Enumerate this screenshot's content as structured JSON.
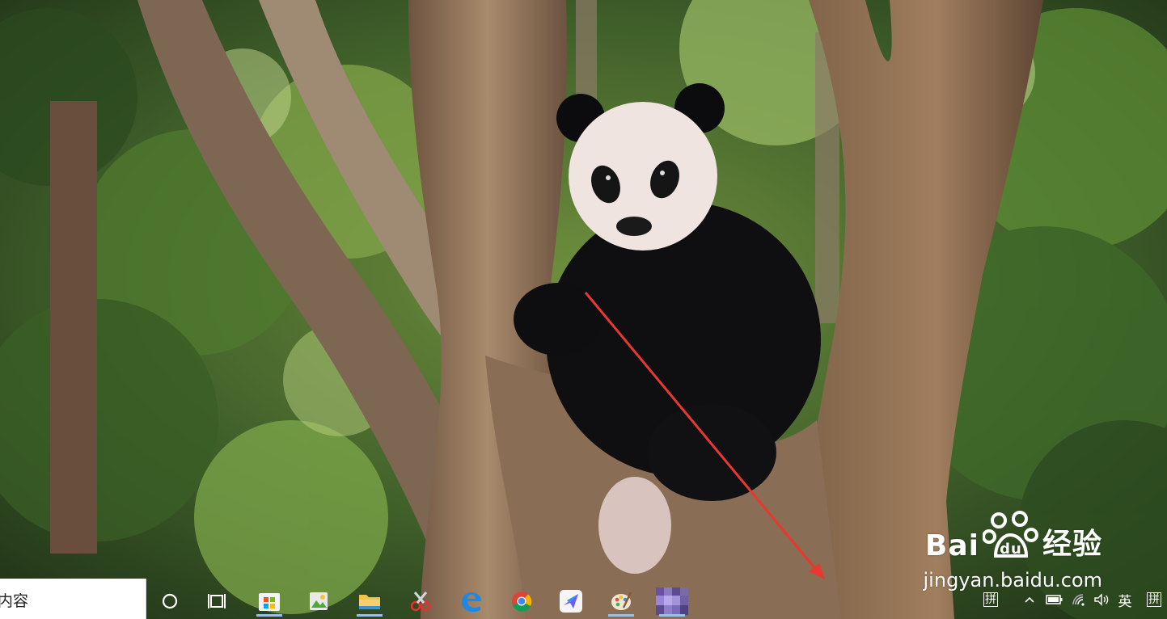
{
  "desktop": {
    "wallpaper": "giant panda sitting in a tree fork, forest background"
  },
  "taskbar": {
    "search": {
      "text": "内容",
      "icon": "search-box"
    },
    "cortana_icon": "cortana-circle-icon",
    "task_view_icon": "task-view-icon",
    "apps": [
      {
        "name": "microsoft-store-icon",
        "active": true
      },
      {
        "name": "image-viewer-icon",
        "active": false
      },
      {
        "name": "file-explorer-icon",
        "active": true
      },
      {
        "name": "snipping-tool-icon",
        "active": false
      },
      {
        "name": "edge-browser-icon",
        "active": false
      },
      {
        "name": "chrome-icon",
        "active": false
      },
      {
        "name": "feishu-lark-icon",
        "active": false
      },
      {
        "name": "paint-palette-icon",
        "active": true
      },
      {
        "name": "blurred-app-icon",
        "active": true
      }
    ],
    "tray": {
      "ime_pinyin_left": "拼",
      "language": "英",
      "ime_pinyin_right": "拼"
    }
  },
  "watermark": {
    "brand_latin": "Bai",
    "brand_cjk": "经验",
    "url": "jingyan.baidu.com"
  },
  "annotation": {
    "arrow_color": "#e8382f"
  },
  "colors": {
    "taskbar_active": "#9bbfe6",
    "search_bg": "#ffffff"
  }
}
